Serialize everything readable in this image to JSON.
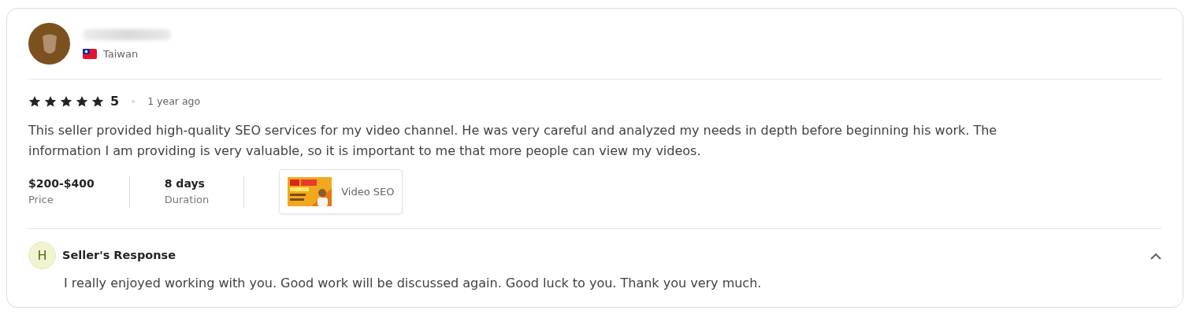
{
  "reviewer": {
    "country": "Taiwan"
  },
  "rating": {
    "stars": 5,
    "score": "5",
    "time": "1 year ago"
  },
  "review_text": "This seller provided high-quality SEO services for my video channel. He was very careful and analyzed my needs in depth before beginning his work. The information I am providing is very valuable, so it is important to me that more people can view my videos.",
  "details": [
    {
      "value": "$200-$400",
      "label": "Price"
    },
    {
      "value": "8 days",
      "label": "Duration"
    }
  ],
  "gig": {
    "title": "Video SEO"
  },
  "seller_response": {
    "initial": "H",
    "title": "Seller's Response",
    "expanded": true,
    "text": "I really enjoyed working with you. Good work will be discussed again. Good luck to you. Thank you very much."
  }
}
